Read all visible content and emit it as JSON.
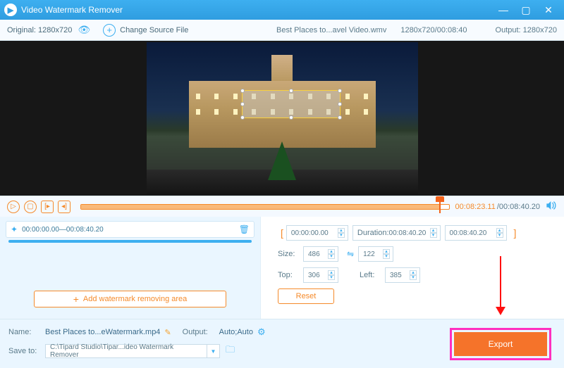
{
  "titlebar": {
    "title": "Video Watermark Remover"
  },
  "toolbar": {
    "original": "Original:  1280x720",
    "changeSource": "Change Source File",
    "filename": "Best Places to...avel Video.wmv",
    "dimdur": "1280x720/00:08:40",
    "output": "Output:   1280x720"
  },
  "timeline": {
    "current": "00:08:23.11",
    "total": "/00:08:40.20"
  },
  "clip": {
    "start": "00:00:00.00",
    "sep": " — ",
    "end": "00:08:40.20",
    "addBtn": "Add watermark removing area"
  },
  "props": {
    "rangeStart": "00:00:00.00",
    "durationLabel": "Duration:",
    "duration": "00:08:40.20",
    "rangeEnd": "00:08:40.20",
    "sizeLabel": "Size:",
    "sizeW": "486",
    "sizeH": "122",
    "topLabel": "Top:",
    "top": "306",
    "leftLabel": "Left:",
    "left": "385",
    "reset": "Reset"
  },
  "bottom": {
    "nameLabel": "Name:",
    "name": "Best Places to...eWatermark.mp4",
    "outputLabel": "Output:",
    "output": "Auto;Auto",
    "saveToLabel": "Save to:",
    "saveTo": "C:\\Tipard Studio\\Tipar...ideo Watermark Remover",
    "export": "Export"
  }
}
